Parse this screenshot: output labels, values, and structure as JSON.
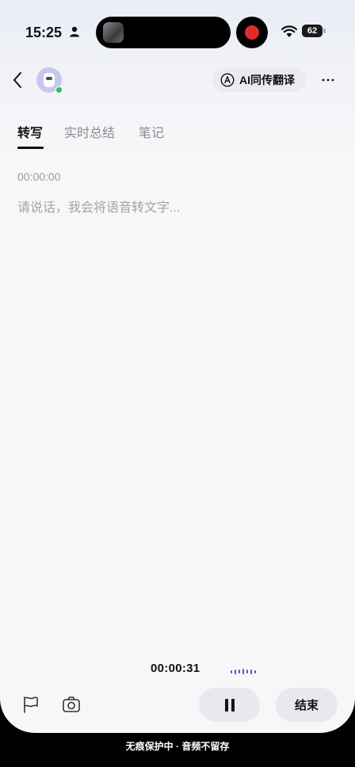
{
  "status_bar": {
    "time": "15:25",
    "battery_level": "62",
    "recording_color": "#e02b2b"
  },
  "header": {
    "back_icon": "chevron-left-icon",
    "avatar_icon": "robot-avatar-icon",
    "ai_translate_label": "AI同传翻译",
    "ai_icon": "letter-a-circle-icon",
    "more_icon": "more-horizontal-icon"
  },
  "tabs": [
    {
      "label": "转写",
      "active": true
    },
    {
      "label": "实时总结",
      "active": false
    },
    {
      "label": "笔记",
      "active": false
    }
  ],
  "transcript": {
    "timestamp": "00:00:00",
    "placeholder": "请说话，我会将语音转文字..."
  },
  "recording": {
    "elapsed": "00:00:31",
    "waveform_color": "#4b56d8"
  },
  "toolbar": {
    "flag_icon": "flag-icon",
    "camera_icon": "camera-icon",
    "pause_icon": "pause-icon",
    "end_label": "结束"
  },
  "footer": {
    "note": "无痕保护中 · 音频不留存"
  }
}
